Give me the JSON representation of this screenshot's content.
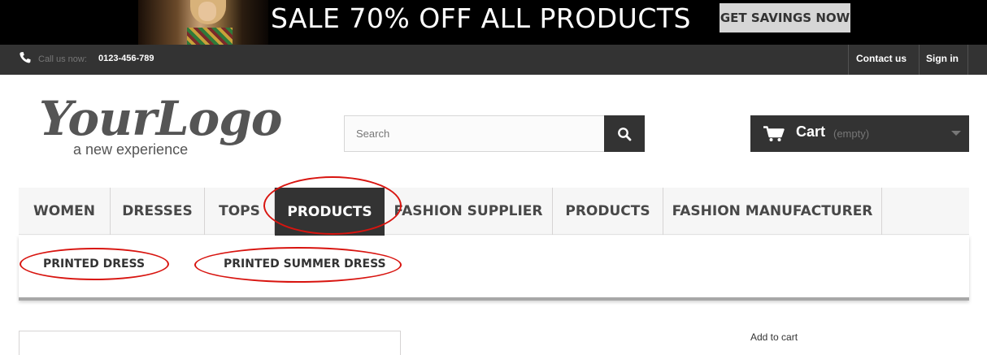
{
  "promo": {
    "headline": "SALE 70% OFF ALL PRODUCTS",
    "button_label": "GET SAVINGS NOW",
    "image": "model-photo"
  },
  "topbar": {
    "phone_icon": "phone-icon",
    "call_label": "Call us now:",
    "call_number": "0123-456-789",
    "links": [
      "Contact us",
      "Sign in"
    ]
  },
  "header": {
    "logo_script": "YourLogo",
    "logo_tagline": "a new experience",
    "search_placeholder": "Search",
    "search_icon": "magnifier-icon",
    "cart": {
      "label": "Cart",
      "status": "(empty)",
      "icon": "cart-icon"
    }
  },
  "menu": {
    "items": [
      "WOMEN",
      "DRESSES",
      "TOPS",
      "PRODUCTS",
      "FASHION SUPPLIER",
      "PRODUCTS",
      "FASHION MANUFACTURER"
    ],
    "active": "PRODUCTS"
  },
  "submenu": {
    "items": [
      "PRINTED DRESS",
      "PRINTED SUMMER DRESS"
    ]
  },
  "content": {
    "add_to_cart": "Add to cart"
  },
  "colors": {
    "dark": "#333333",
    "annotation": "#d8140f",
    "menu_bg": "#f6f6f6"
  }
}
